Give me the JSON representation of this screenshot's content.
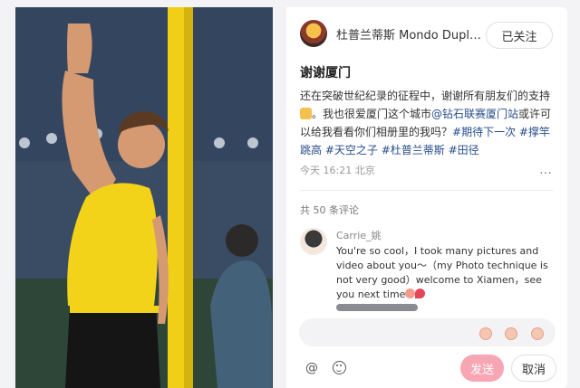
{
  "author": {
    "name": "杜普兰蒂斯 Mondo Duplantis",
    "follow_label": "已关注"
  },
  "post": {
    "title": "谢谢厦门",
    "body_lines": {
      "p1": "还在突破世纪纪录的征程中，谢谢所有朋友们的支持",
      "p2": "。我也很爱厦门这个城市",
      "mention": "@钻石联赛厦门站",
      "p3": "或许可以给我看看你们相册里的我吗？",
      "tag1": "#期待下一次",
      "tag2": "#撑竿跳高",
      "tag3": "#天空之子",
      "tag4": "#杜普兰蒂斯",
      "tag5": "#田径"
    },
    "meta": "今天 16:21 北京",
    "more_icon": "…"
  },
  "comments": {
    "count_label": "共 50 条评论",
    "items": [
      {
        "user": "Carrie_姚",
        "text": "You're so cool，I took many pictures and video about you～（my Photo technique is not very good）welcome to Xiamen，see you next time"
      }
    ]
  },
  "composer": {
    "at_icon": "@",
    "send_label": "发送",
    "cancel_label": "取消"
  },
  "colors": {
    "tag": "#284d8c",
    "send_button": "#f7a6b4",
    "singlet": "#f3d21a"
  },
  "icons": [
    "at-icon",
    "emoji-icon",
    "more-icon",
    "reaction-face-icon"
  ]
}
